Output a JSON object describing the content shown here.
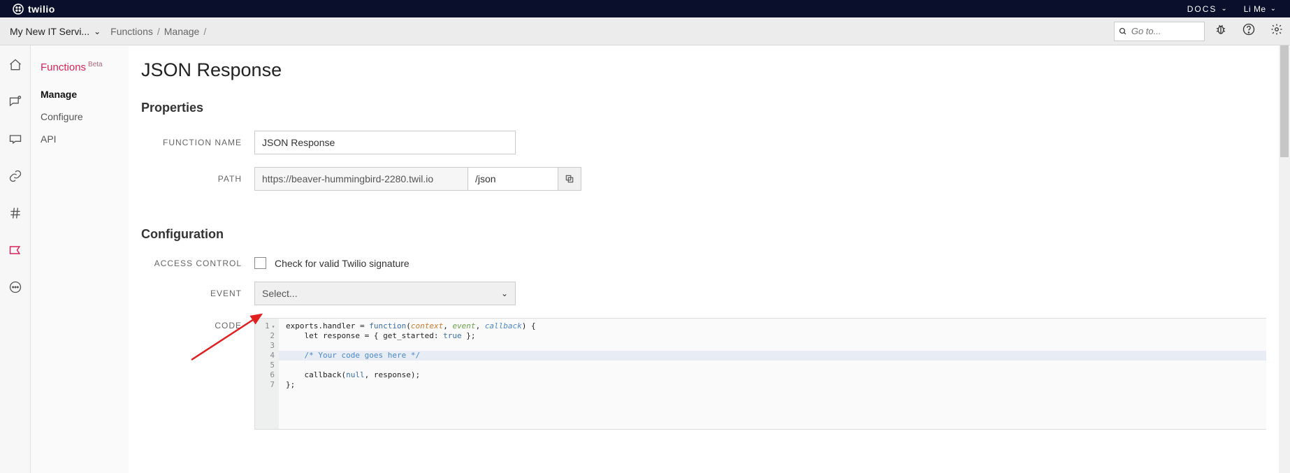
{
  "topbar": {
    "brand": "twilio",
    "docs_label": "DOCS",
    "user_label": "Li Me"
  },
  "subbar": {
    "project_name": "My New IT Servi...",
    "crumb1": "Functions",
    "crumb2": "Manage",
    "search_placeholder": "Go to..."
  },
  "sidebar": {
    "title": "Functions",
    "beta": "Beta",
    "items": [
      "Manage",
      "Configure",
      "API"
    ],
    "selected_index": 0
  },
  "page": {
    "title": "JSON Response",
    "section_props": "Properties",
    "label_fn_name": "FUNCTION NAME",
    "fn_name_value": "JSON Response",
    "label_path": "PATH",
    "path_base": "https://beaver-hummingbird-2280.twil.io",
    "path_slug": "/json",
    "section_config": "Configuration",
    "label_access": "ACCESS CONTROL",
    "access_checkbox_label": "Check for valid Twilio signature",
    "label_event": "EVENT",
    "event_selected": "Select...",
    "label_code": "CODE"
  },
  "code": {
    "lines_count": 7,
    "highlight_line": 4,
    "l1_a": "exports.handler ",
    "l1_b": "= ",
    "l1_c": "function",
    "l1_d": "(",
    "l1_arg1": "context",
    "l1_comma1": ", ",
    "l1_arg2": "event",
    "l1_comma2": ", ",
    "l1_arg3": "callback",
    "l1_e": ") {",
    "l2_a": "    let response = { get_started: ",
    "l2_b": "true",
    "l2_c": " };",
    "l3": "",
    "l4_a": "    ",
    "l4_b": "/* Your code goes here */",
    "l5": "",
    "l6_a": "    callback(",
    "l6_b": "null",
    "l6_c": ", response);",
    "l7": "};"
  }
}
